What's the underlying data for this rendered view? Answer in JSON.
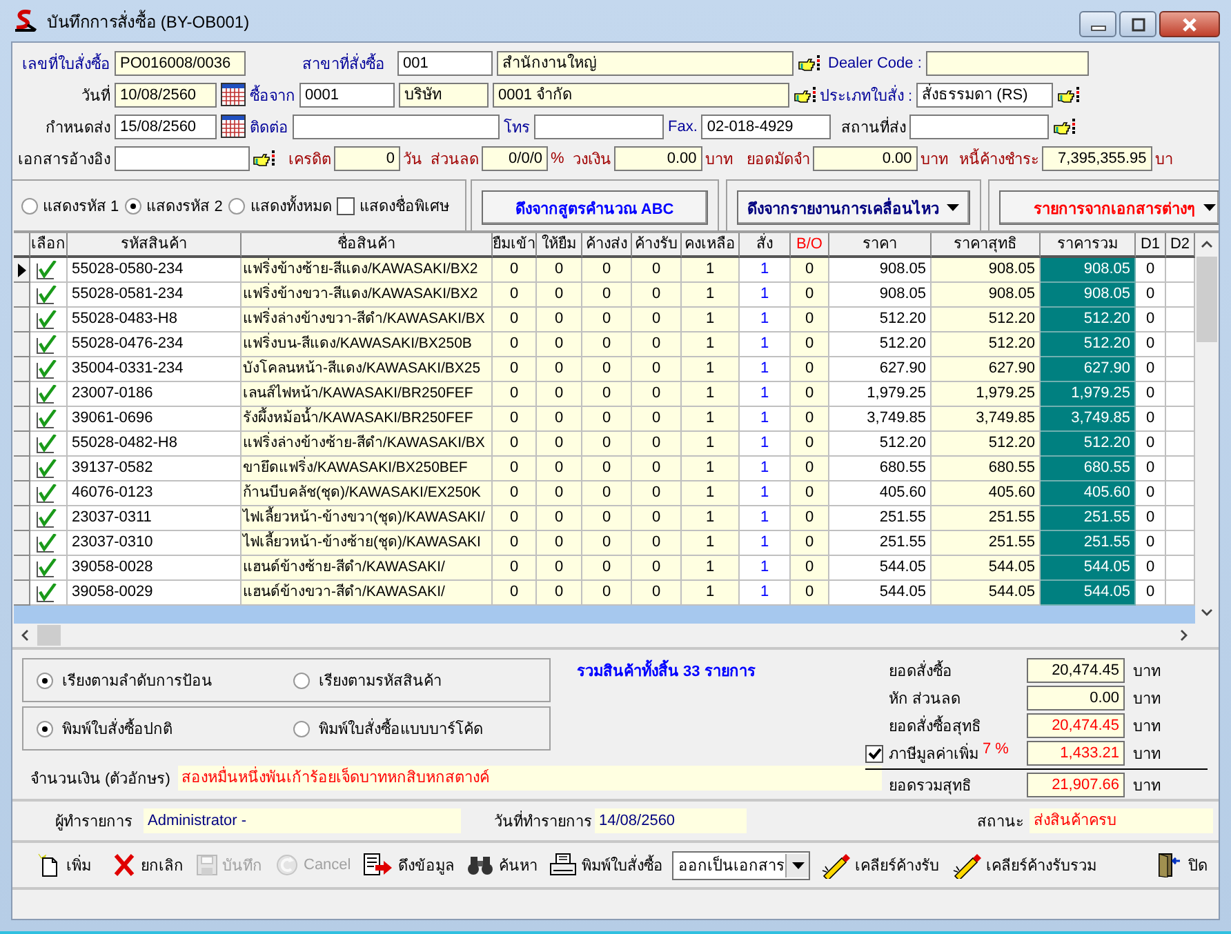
{
  "window": {
    "title": "บันทึกการสั่งซื้อ (BY-OB001)"
  },
  "header": [
    [
      {
        "kind": "link-label",
        "text": "เลขที่ใบสั่งซื้อ"
      },
      {
        "kind": "field",
        "value": "PO016008/0036",
        "readonly": true
      },
      {
        "kind": "link-label",
        "text": "สาขาที่สั่งซื้อ"
      },
      {
        "kind": "field",
        "value": "001",
        "readonly": false
      },
      {
        "kind": "field",
        "value": "สำนักงานใหญ่",
        "readonly": true
      },
      {
        "kind": "lookup"
      },
      {
        "kind": "link-label",
        "text": "Dealer Code :"
      },
      {
        "kind": "field",
        "readonly": true
      }
    ],
    [
      {
        "kind": "label",
        "text": "วันที่"
      },
      {
        "kind": "field",
        "value": "10/08/2560",
        "readonly": true
      },
      {
        "kind": "calendar"
      },
      {
        "kind": "link-label",
        "text": "ซื้อจาก"
      },
      {
        "kind": "field",
        "value": "0001",
        "readonly": false
      },
      {
        "kind": "field",
        "value": "บริษัท",
        "readonly": true
      },
      {
        "kind": "field",
        "value": "0001 จำกัด",
        "readonly": true
      },
      {
        "kind": "lookup"
      },
      {
        "kind": "link-label",
        "text": "ประเภทใบสั่ง :"
      },
      {
        "kind": "field",
        "value": "สั่งธรรมดา (RS)",
        "readonly": false
      },
      {
        "kind": "lookup"
      }
    ],
    [
      {
        "kind": "label",
        "text": "กำหนดส่ง"
      },
      {
        "kind": "field",
        "value": "15/08/2560",
        "readonly": false
      },
      {
        "kind": "calendar"
      },
      {
        "kind": "link-label",
        "text": "ติดต่อ"
      },
      {
        "kind": "field",
        "readonly": false
      },
      {
        "kind": "link-label",
        "text": "โทร"
      },
      {
        "kind": "field",
        "readonly": false
      },
      {
        "kind": "link-label",
        "text": "Fax."
      },
      {
        "kind": "field",
        "value": "02-018-4929",
        "readonly": false
      },
      {
        "kind": "label",
        "text": "สถานที่ส่ง"
      },
      {
        "kind": "field",
        "readonly": false
      },
      {
        "kind": "lookup"
      }
    ],
    [
      {
        "kind": "label",
        "text": "เอกสารอ้างอิง"
      },
      {
        "kind": "field",
        "readonly": false
      },
      {
        "kind": "lookup"
      },
      {
        "kind": "money-label",
        "text": "เครดิต"
      },
      {
        "kind": "number-field",
        "value": "0",
        "readonly": true
      },
      {
        "kind": "money-label",
        "text": "วัน"
      },
      {
        "kind": "money-label",
        "text": "ส่วนลด"
      },
      {
        "kind": "number-field",
        "value": "0/0/0",
        "readonly": true
      },
      {
        "kind": "money-label",
        "text": "%"
      },
      {
        "kind": "money-label",
        "text": "วงเงิน"
      },
      {
        "kind": "number-field",
        "value": "0.00",
        "readonly": true
      },
      {
        "kind": "money-label",
        "text": "บาท"
      },
      {
        "kind": "money-label",
        "text": "ยอดมัดจำ"
      },
      {
        "kind": "number-field",
        "value": "0.00",
        "readonly": true
      },
      {
        "kind": "money-label",
        "text": "บาท"
      },
      {
        "kind": "money-label",
        "text": "หนี้ค้างชำระ"
      },
      {
        "kind": "number-field",
        "value": "7,395,355.95",
        "readonly": true
      },
      {
        "kind": "money-label",
        "text": "บา"
      }
    ]
  ],
  "display_options": [
    {
      "kind": "radio",
      "label": "แสดงรหัส 1",
      "selected": false
    },
    {
      "kind": "radio",
      "label": "แสดงรหัส 2",
      "selected": true
    },
    {
      "kind": "radio",
      "label": "แสดงทั้งหมด",
      "selected": false
    },
    {
      "kind": "checkbox",
      "label": "แสดงชื่อพิเศษ",
      "checked": false
    }
  ],
  "import_buttons": [
    {
      "label": "ดึงจากสูตรคำนวณ ABC",
      "color": "#0000ff",
      "dropdown": false
    },
    {
      "label": "ดึงจากรายงานการเคลื่อนไหว",
      "color": "#000080",
      "dropdown": true
    },
    {
      "label": "รายการจากเอกสารต่างๆ",
      "color": "#ff0000",
      "dropdown": true
    }
  ],
  "grid": {
    "check_column": "เลือก",
    "columns": [
      "รหัสสินค้า",
      "ชื่อสินค้า",
      "ยืมเข้า",
      "ให้ยืม",
      "ค้างส่ง",
      "ค้างรับ",
      "คงเหลือ",
      "สั่ง",
      "B/O",
      "ราคา",
      "ราคาสุทธิ",
      "ราคารวม",
      "D1",
      "D2"
    ],
    "rows": [
      {
        "current": true,
        "checked": true,
        "cells": [
          "55028-0580-234",
          "แฟริ่งข้างซ้าย-สีแดง/KAWASAKI/BX2",
          "0",
          "0",
          "0",
          "0",
          "1",
          "1",
          "0",
          "908.05",
          "908.05",
          "908.05",
          "0"
        ]
      },
      {
        "current": false,
        "checked": true,
        "cells": [
          "55028-0581-234",
          "แฟริ่งข้างขวา-สีแดง/KAWASAKI/BX2",
          "0",
          "0",
          "0",
          "0",
          "1",
          "1",
          "0",
          "908.05",
          "908.05",
          "908.05",
          "0"
        ]
      },
      {
        "current": false,
        "checked": true,
        "cells": [
          "55028-0483-H8",
          "แฟริ่งล่างข้างขวา-สีดำ/KAWASAKI/BX",
          "0",
          "0",
          "0",
          "0",
          "1",
          "1",
          "0",
          "512.20",
          "512.20",
          "512.20",
          "0"
        ]
      },
      {
        "current": false,
        "checked": true,
        "cells": [
          "55028-0476-234",
          "แฟริ่งบน-สีแดง/KAWASAKI/BX250B",
          "0",
          "0",
          "0",
          "0",
          "1",
          "1",
          "0",
          "512.20",
          "512.20",
          "512.20",
          "0"
        ]
      },
      {
        "current": false,
        "checked": true,
        "cells": [
          "35004-0331-234",
          "บังโคลนหน้า-สีแดง/KAWASAKI/BX25",
          "0",
          "0",
          "0",
          "0",
          "1",
          "1",
          "0",
          "627.90",
          "627.90",
          "627.90",
          "0"
        ]
      },
      {
        "current": false,
        "checked": true,
        "cells": [
          "23007-0186",
          "เลนส์ไฟหน้า/KAWASAKI/BR250FEF",
          "0",
          "0",
          "0",
          "0",
          "1",
          "1",
          "0",
          "1,979.25",
          "1,979.25",
          "1,979.25",
          "0"
        ]
      },
      {
        "current": false,
        "checked": true,
        "cells": [
          "39061-0696",
          "รังผึ้งหม้อน้ำ/KAWASAKI/BR250FEF",
          "0",
          "0",
          "0",
          "0",
          "1",
          "1",
          "0",
          "3,749.85",
          "3,749.85",
          "3,749.85",
          "0"
        ]
      },
      {
        "current": false,
        "checked": true,
        "cells": [
          "55028-0482-H8",
          "แฟริ่งล่างข้างซ้าย-สีดำ/KAWASAKI/BX",
          "0",
          "0",
          "0",
          "0",
          "1",
          "1",
          "0",
          "512.20",
          "512.20",
          "512.20",
          "0"
        ]
      },
      {
        "current": false,
        "checked": true,
        "cells": [
          "39137-0582",
          "ขายึดแฟริ่ง/KAWASAKI/BX250BEF",
          "0",
          "0",
          "0",
          "0",
          "1",
          "1",
          "0",
          "680.55",
          "680.55",
          "680.55",
          "0"
        ]
      },
      {
        "current": false,
        "checked": true,
        "cells": [
          "46076-0123",
          "ก้านบีบคลัช(ชุด)/KAWASAKI/EX250K",
          "0",
          "0",
          "0",
          "0",
          "1",
          "1",
          "0",
          "405.60",
          "405.60",
          "405.60",
          "0"
        ]
      },
      {
        "current": false,
        "checked": true,
        "cells": [
          "23037-0311",
          "ไฟเลี้ยวหน้า-ข้างขวา(ชุด)/KAWASAKI/",
          "0",
          "0",
          "0",
          "0",
          "1",
          "1",
          "0",
          "251.55",
          "251.55",
          "251.55",
          "0"
        ]
      },
      {
        "current": false,
        "checked": true,
        "cells": [
          "23037-0310",
          "ไฟเลี้ยวหน้า-ข้างซ้าย(ชุด)/KAWASAKI",
          "0",
          "0",
          "0",
          "0",
          "1",
          "1",
          "0",
          "251.55",
          "251.55",
          "251.55",
          "0"
        ]
      },
      {
        "current": false,
        "checked": true,
        "cells": [
          "39058-0028",
          "แฮนด์ข้างซ้าย-สีดำ/KAWASAKI/",
          "0",
          "0",
          "0",
          "0",
          "1",
          "1",
          "0",
          "544.05",
          "544.05",
          "544.05",
          "0"
        ]
      },
      {
        "current": false,
        "checked": true,
        "cells": [
          "39058-0029",
          "แฮนด์ข้างขวา-สีดำ/KAWASAKI/",
          "0",
          "0",
          "0",
          "0",
          "1",
          "1",
          "0",
          "544.05",
          "544.05",
          "544.05",
          "0"
        ]
      }
    ]
  },
  "sort_options": [
    {
      "label": "เรียงตามลำดับการป้อน",
      "selected": true
    },
    {
      "label": "เรียงตามรหัสสินค้า",
      "selected": false
    }
  ],
  "print_options": [
    {
      "label": "พิมพ์ใบสั่งซื้อปกติ",
      "selected": true
    },
    {
      "label": "พิมพ์ใบสั่งซื้อแบบบาร์โค้ด",
      "selected": false
    }
  ],
  "item_count": "รวมสินค้าทั้งสิ้น 33 รายการ",
  "amount_in_words": {
    "label": "จำนวนเงิน (ตัวอักษร)",
    "value": "สองหมื่นหนึ่งพันเก้าร้อยเจ็ดบาทหกสิบหกสตางค์"
  },
  "totals": [
    {
      "kind": "amount",
      "label": "ยอดสั่งซื้อ",
      "value": "20,474.45",
      "unit": "บาท",
      "emphasis": false
    },
    {
      "kind": "amount",
      "label": "หัก ส่วนลด",
      "value": "0.00",
      "unit": "บาท",
      "emphasis": false
    },
    {
      "kind": "amount",
      "label": "ยอดสั่งซื้อสุทธิ",
      "value": "20,474.45",
      "unit": "บาท",
      "emphasis": true
    },
    {
      "kind": "vat",
      "checked": true,
      "label": "ภาษีมูลค่าเพิ่ม",
      "rate": "7 %",
      "value": "1,433.21",
      "unit": "บาท",
      "emphasis": true
    },
    {
      "kind": "total",
      "label": "ยอดรวมสุทธิ",
      "value": "21,907.66",
      "unit": "บาท",
      "emphasis": true
    }
  ],
  "audit": [
    {
      "label": "ผู้ทำรายการ",
      "value": "Administrator -",
      "alert": false
    },
    {
      "label": "วันที่ทำรายการ",
      "value": "14/08/2560",
      "alert": false
    },
    {
      "label": "สถานะ",
      "value": "ส่งสินค้าครบ",
      "alert": true
    }
  ],
  "toolbar": [
    {
      "kind": "add",
      "label": "เพิ่ม",
      "disabled": false
    },
    {
      "kind": "cancel",
      "label": "ยกเลิก",
      "disabled": false
    },
    {
      "kind": "save",
      "label": "บันทึก",
      "disabled": true
    },
    {
      "kind": "undo",
      "label": "Cancel",
      "disabled": true
    },
    {
      "kind": "import",
      "label": "ดึงข้อมูล",
      "disabled": false
    },
    {
      "kind": "search",
      "label": "ค้นหา",
      "disabled": false
    },
    {
      "kind": "print",
      "label": "พิมพ์ใบสั่งซื้อ",
      "disabled": false
    },
    {
      "kind": "select",
      "value": "ออกเป็นเอกสาร",
      "disabled": false
    },
    {
      "kind": "clear",
      "label": "เคลียร์ค้างรับ",
      "disabled": false
    },
    {
      "kind": "clear-all",
      "label": "เคลียร์ค้างรับรวม",
      "disabled": false
    },
    {
      "kind": "close",
      "label": "ปิด",
      "disabled": false
    }
  ]
}
